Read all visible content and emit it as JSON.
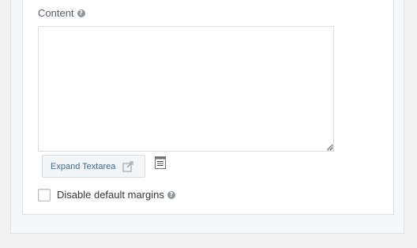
{
  "content_field": {
    "label": "Content",
    "help_icon": "question-circle-icon",
    "value": ""
  },
  "expand_button": {
    "label": "Expand Textarea",
    "icon": "edit-external-icon"
  },
  "doc_icon": "document-lines-icon",
  "margins_option": {
    "label": "Disable default margins",
    "checked": false,
    "help_icon": "question-circle-icon"
  },
  "colors": {
    "link_blue": "#3d6d92",
    "help_grey": "#8f979d",
    "panel_border": "#d9e1e7"
  }
}
